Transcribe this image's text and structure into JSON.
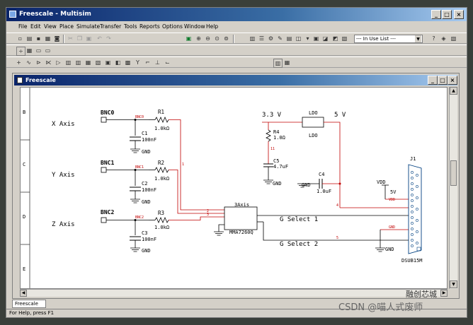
{
  "app": {
    "title": "Freescale - Multisim"
  },
  "menu": [
    "File",
    "Edit",
    "View",
    "Place",
    "Simulate",
    "Transfer",
    "Tools",
    "Reports",
    "Options",
    "Window",
    "Help"
  ],
  "toolbar": {
    "in_use_list": "--- In Use List ---"
  },
  "document": {
    "title": "Freescale",
    "sheet_tab": "Freescale"
  },
  "status": {
    "text": "For Help, press F1"
  },
  "border_labels": [
    "B",
    "C",
    "D",
    "E"
  ],
  "schematic": {
    "connectors": [
      {
        "axis": "X Axis",
        "bnc": "BNC0",
        "net": "BNC0",
        "resistor": "R1",
        "res_value": "1.0kΩ",
        "cap": "C1",
        "cap_value": "100nF",
        "gnd": "GND",
        "wire": "1"
      },
      {
        "axis": "Y Axis",
        "bnc": "BNC1",
        "net": "BNC1",
        "resistor": "R2",
        "res_value": "1.0kΩ",
        "cap": "C2",
        "cap_value": "100nF",
        "gnd": "GND",
        "wire": ""
      },
      {
        "axis": "Z Axis",
        "bnc": "BNC2",
        "net": "BNC2",
        "resistor": "R3",
        "res_value": "1.0kΩ",
        "cap": "C3",
        "cap_value": "100nF",
        "gnd": "GND",
        "wire": "3"
      }
    ],
    "net_labels": [
      "2",
      "4",
      "5",
      "11"
    ],
    "supply": {
      "left": "3.3 V",
      "right": "5 V",
      "ldo_ref": "LDO",
      "ldo_value": "LDO",
      "vdd": "VDD",
      "five_v": "5V",
      "vdd_small": "VDD",
      "gnd_small": "GND"
    },
    "r4": {
      "ref": "R4",
      "value": "1.0Ω"
    },
    "c5": {
      "ref": "C5",
      "value": "4.7uF"
    },
    "c4": {
      "ref": "C4",
      "value": "1.0uF"
    },
    "gnd_labels": [
      "GND",
      "GND",
      "GND",
      "GND"
    ],
    "chip": {
      "ref": "3Axis",
      "value": "MMA7260Q"
    },
    "g_select_1": "G Select 1",
    "g_select_2": "G Select 2",
    "connector": {
      "ref": "J1",
      "value": "DSUB15M"
    }
  },
  "watermark": {
    "csdn": "CSDN",
    "handle": "@喵人式废师",
    "brand": "融创芯城"
  }
}
